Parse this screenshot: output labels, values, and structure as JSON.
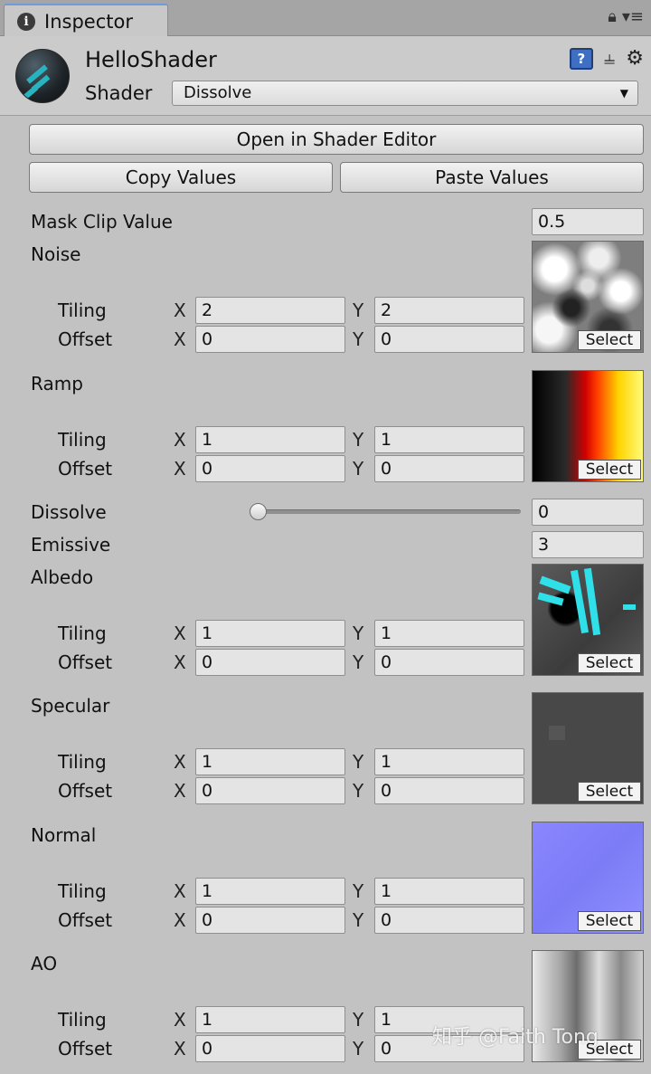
{
  "tab": {
    "title": "Inspector",
    "icon": "info-icon"
  },
  "material": {
    "name": "HelloShader",
    "shader_label": "Shader",
    "shader_value": "Dissolve"
  },
  "buttons": {
    "open_editor": "Open in Shader Editor",
    "copy": "Copy Values",
    "paste": "Paste Values"
  },
  "props": {
    "mask_clip": {
      "label": "Mask Clip Value",
      "value": "0.5"
    },
    "dissolve": {
      "label": "Dissolve",
      "value": "0",
      "slider_fraction": 0
    },
    "emissive": {
      "label": "Emissive",
      "value": "3"
    }
  },
  "common": {
    "tiling": "Tiling",
    "offset": "Offset",
    "x": "X",
    "y": "Y",
    "select": "Select"
  },
  "textures": [
    {
      "label": "Noise",
      "tiling_x": "2",
      "tiling_y": "2",
      "offset_x": "0",
      "offset_y": "0"
    },
    {
      "label": "Ramp",
      "tiling_x": "1",
      "tiling_y": "1",
      "offset_x": "0",
      "offset_y": "0"
    },
    {
      "label": "Albedo",
      "tiling_x": "1",
      "tiling_y": "1",
      "offset_x": "0",
      "offset_y": "0"
    },
    {
      "label": "Specular",
      "tiling_x": "1",
      "tiling_y": "1",
      "offset_x": "0",
      "offset_y": "0"
    },
    {
      "label": "Normal",
      "tiling_x": "1",
      "tiling_y": "1",
      "offset_x": "0",
      "offset_y": "0"
    },
    {
      "label": "AO",
      "tiling_x": "1",
      "tiling_y": "1",
      "offset_x": "0",
      "offset_y": "0"
    }
  ],
  "watermark": "知乎 @Faith Tong"
}
